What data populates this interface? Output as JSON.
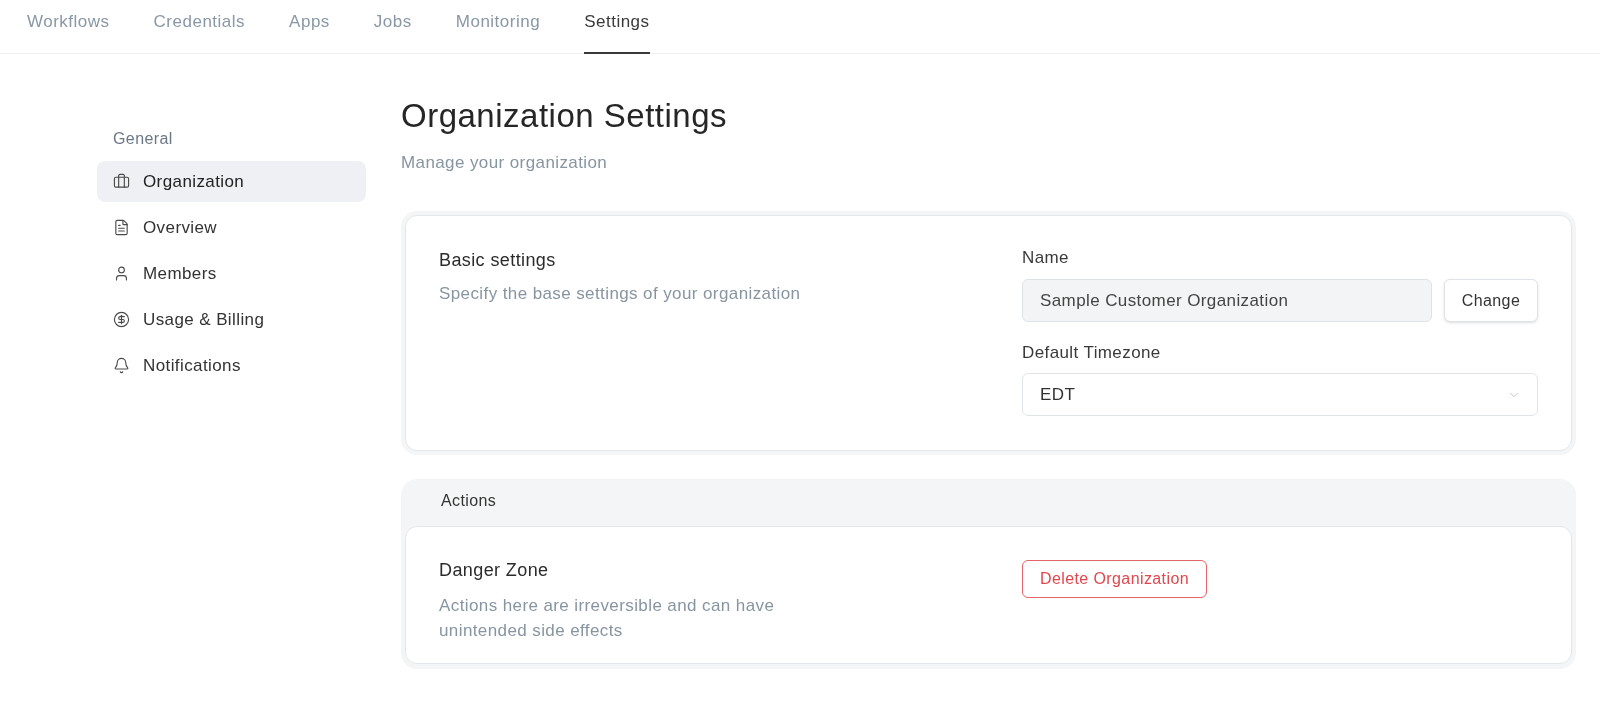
{
  "nav": {
    "tabs": [
      {
        "label": "Workflows",
        "selected": false
      },
      {
        "label": "Credentials",
        "selected": false
      },
      {
        "label": "Apps",
        "selected": false
      },
      {
        "label": "Jobs",
        "selected": false
      },
      {
        "label": "Monitoring",
        "selected": false
      },
      {
        "label": "Settings",
        "selected": true
      }
    ]
  },
  "sidebar": {
    "section_label": "General",
    "items": [
      {
        "label": "Organization",
        "selected": true
      },
      {
        "label": "Overview",
        "selected": false
      },
      {
        "label": "Members",
        "selected": false
      },
      {
        "label": "Usage & Billing",
        "selected": false
      },
      {
        "label": "Notifications",
        "selected": false
      }
    ]
  },
  "header": {
    "title": "Organization Settings",
    "subtitle": "Manage your organization"
  },
  "basic_settings": {
    "title": "Basic settings",
    "description": "Specify the base settings of your organization",
    "name_field": {
      "label": "Name",
      "value": "Sample Customer Organization",
      "read_only": true
    },
    "change_button": "Change",
    "timezone_field": {
      "label": "Default Timezone",
      "value": "EDT"
    }
  },
  "actions": {
    "label": "Actions",
    "danger_zone": {
      "title": "Danger Zone",
      "description": "Actions here are irreversible and can have unintended side effects",
      "button": "Delete Organization"
    }
  }
}
